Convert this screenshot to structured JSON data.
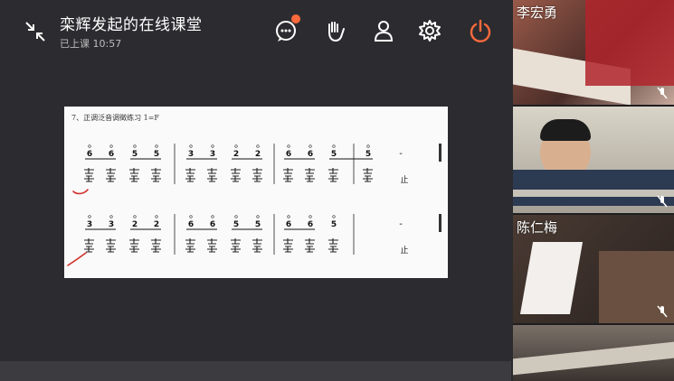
{
  "header": {
    "title": "栾辉发起的在线课堂",
    "status_prefix": "已上课",
    "elapsed": "10:57"
  },
  "toolbar": {
    "icons": [
      "collapse-icon",
      "chat-icon",
      "raise-hand-icon",
      "members-icon",
      "settings-icon",
      "power-icon"
    ],
    "accent": "#ff6a3d"
  },
  "board": {
    "title": "7、正调泛音调徵练习 1=F",
    "row1_notes": [
      "6",
      "6",
      "5",
      "5",
      "3",
      "3",
      "2",
      "2",
      "6",
      "6",
      "5",
      "5"
    ],
    "row2_notes": [
      "3",
      "3",
      "2",
      "2",
      "6",
      "6",
      "5",
      "5",
      "6",
      "6",
      "5"
    ],
    "row_end_mark": "止",
    "dash": "-"
  },
  "participants": [
    {
      "name": "李宏勇"
    },
    {
      "name": ""
    },
    {
      "name": "陈仁梅"
    },
    {
      "name": ""
    }
  ]
}
